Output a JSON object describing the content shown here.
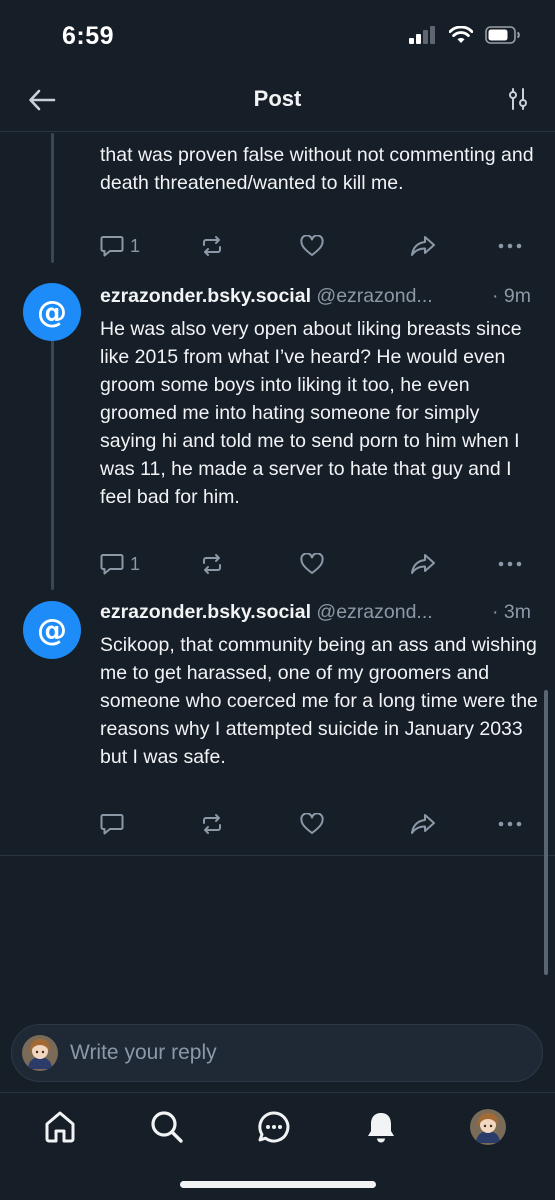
{
  "status_bar": {
    "time": "6:59"
  },
  "header": {
    "title": "Post"
  },
  "posts": [
    {
      "text": "that was proven false without not commenting and death threatened/wanted to kill me.",
      "reply_count": "1"
    },
    {
      "author": "ezrazonder.bsky.social",
      "handle": "@ezrazond...",
      "time": "· 9m",
      "avatar_glyph": "@",
      "text": "He was also very open about liking breasts since like 2015 from what I’ve heard? He would even groom some boys into liking it too, he even groomed me into hating someone for simply saying hi and told me to send porn to him when I was 11, he made a server to hate that guy and I feel bad for him.",
      "reply_count": "1"
    },
    {
      "author": "ezrazonder.bsky.social",
      "handle": "@ezrazond...",
      "time": "· 3m",
      "avatar_glyph": "@",
      "text": "Scikoop, that community being an ass and wishing me to get harassed, one of my groomers and someone who coerced me for a long time were the reasons why I attempted suicide in January 2033 but I was safe.",
      "reply_count": ""
    }
  ],
  "reply": {
    "placeholder": "Write your reply"
  },
  "tabs": [
    "home-icon",
    "search-icon",
    "chat-icon",
    "bell-icon",
    "profile-avatar"
  ],
  "colors": {
    "background": "#161e27",
    "accent": "#1d8cf8",
    "muted": "#8b98a7",
    "divider": "#2a3543"
  }
}
